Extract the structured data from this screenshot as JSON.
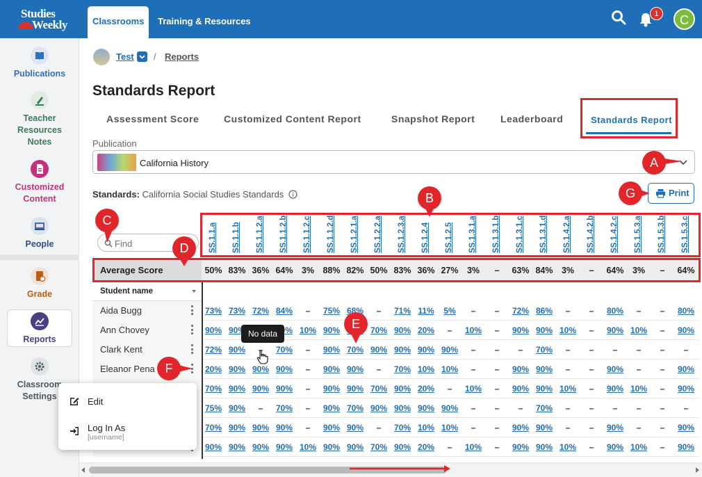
{
  "header": {
    "logo_line1": "Studies",
    "logo_line2": "Weekly",
    "tabs": [
      {
        "label": "Classrooms",
        "active": true
      },
      {
        "label": "Training & Resources",
        "active": false
      }
    ],
    "notification_count": "1",
    "avatar_initial": "C"
  },
  "sidebar": {
    "items": [
      {
        "label": "Publications",
        "icon": "book-icon",
        "color": "#2f6fbf"
      },
      {
        "label": "Teacher Resources Notes",
        "icon": "highlighter-icon",
        "color": "#3b7a5a"
      },
      {
        "label": "Customized Content",
        "icon": "document-icon",
        "color": "#c2317b"
      },
      {
        "label": "People",
        "icon": "people-icon",
        "color": "#2f4f86"
      },
      {
        "label": "Grade",
        "icon": "grade-icon",
        "color": "#b85e1a"
      },
      {
        "label": "Reports",
        "icon": "chart-icon",
        "color": "#4b3f83"
      },
      {
        "label": "Classroom Settings",
        "icon": "gear-icon",
        "color": "#4b5a60"
      }
    ]
  },
  "breadcrumb": {
    "classroom": "Test",
    "current": "Reports",
    "separator": "/"
  },
  "page": {
    "title": "Standards Report"
  },
  "report_tabs": [
    {
      "label": "Assessment Score",
      "active": false
    },
    {
      "label": "Customized Content Report",
      "active": false
    },
    {
      "label": "Snapshot Report",
      "active": false
    },
    {
      "label": "Leaderboard",
      "active": false
    },
    {
      "label": "Standards Report",
      "active": true
    }
  ],
  "publication": {
    "label": "Publication",
    "selected": "California History"
  },
  "standards": {
    "label": "Standards:",
    "value": "California Social Studies Standards"
  },
  "print_label": "Print",
  "find": {
    "placeholder": "Find"
  },
  "table": {
    "standard_codes": [
      "SS.1.1.a",
      "SS.1.1.b",
      "SS.1.1.2.a",
      "SS.1.1.2.b",
      "SS.1.1.2.c",
      "SS.1.1.2.d",
      "SS.1.2.1.a",
      "SS.1.2.2.a",
      "SS.1.2.3.a",
      "SS.1.2.4",
      "SS.1.2.5",
      "SS.1.3.1.a",
      "SS.1.3.1.b",
      "SS.1.3.1.c",
      "SS.1.3.1.d",
      "SS.1.4.2.a",
      "SS.1.4.2.b",
      "SS.1.4.2.c",
      "SS.1.5.3.a",
      "SS.1.5.3.b",
      "SS.1.5.3.c"
    ],
    "average_label": "Average Score",
    "averages": [
      "50%",
      "83%",
      "36%",
      "64%",
      "3%",
      "88%",
      "82%",
      "50%",
      "83%",
      "36%",
      "27%",
      "3%",
      "–",
      "63%",
      "84%",
      "3%",
      "–",
      "64%",
      "3%",
      "–",
      "64%"
    ],
    "name_header": "Student name",
    "rows": [
      {
        "name": "Aida Bugg",
        "values": [
          "73%",
          "73%",
          "72%",
          "84%",
          "–",
          "75%",
          "68%",
          "–",
          "71%",
          "11%",
          "5%",
          "–",
          "–",
          "72%",
          "86%",
          "–",
          "–",
          "80%",
          "–",
          "–",
          "80%"
        ]
      },
      {
        "name": "Ann Chovey",
        "values": [
          "90%",
          "90%",
          "",
          "90%",
          "10%",
          "90%",
          "90%",
          "70%",
          "90%",
          "20%",
          "–",
          "10%",
          "–",
          "90%",
          "90%",
          "10%",
          "–",
          "90%",
          "10%",
          "–",
          "90%"
        ]
      },
      {
        "name": "Clark Kent",
        "values": [
          "72%",
          "90%",
          "–",
          "70%",
          "–",
          "90%",
          "70%",
          "90%",
          "90%",
          "90%",
          "90%",
          "–",
          "–",
          "–",
          "70%",
          "–",
          "–",
          "–",
          "–",
          "–",
          "–"
        ]
      },
      {
        "name": "Eleanor Pena",
        "values": [
          "20%",
          "90%",
          "90%",
          "90%",
          "–",
          "90%",
          "90%",
          "–",
          "70%",
          "10%",
          "10%",
          "–",
          "–",
          "90%",
          "90%",
          "–",
          "–",
          "90%",
          "–",
          "–",
          "90%"
        ]
      },
      {
        "name": "",
        "values": [
          "70%",
          "90%",
          "90%",
          "90%",
          "–",
          "90%",
          "90%",
          "70%",
          "90%",
          "20%",
          "–",
          "10%",
          "–",
          "90%",
          "90%",
          "10%",
          "–",
          "90%",
          "10%",
          "–",
          "90%"
        ]
      },
      {
        "name": "",
        "values": [
          "75%",
          "90%",
          "–",
          "70%",
          "–",
          "90%",
          "70%",
          "90%",
          "90%",
          "90%",
          "90%",
          "–",
          "–",
          "–",
          "70%",
          "–",
          "–",
          "–",
          "–",
          "–",
          "–"
        ]
      },
      {
        "name": "",
        "values": [
          "70%",
          "90%",
          "90%",
          "90%",
          "–",
          "90%",
          "90%",
          "–",
          "70%",
          "10%",
          "10%",
          "–",
          "–",
          "90%",
          "90%",
          "–",
          "–",
          "90%",
          "–",
          "–",
          "90%"
        ]
      },
      {
        "name": "",
        "values": [
          "90%",
          "90%",
          "90%",
          "90%",
          "10%",
          "90%",
          "90%",
          "70%",
          "90%",
          "20%",
          "–",
          "10%",
          "–",
          "90%",
          "90%",
          "10%",
          "–",
          "90%",
          "10%",
          "–",
          "90%"
        ]
      }
    ]
  },
  "context_menu": {
    "edit": "Edit",
    "login_as": "Log In As",
    "login_sub": "[username]"
  },
  "tooltip": "No data",
  "callouts": [
    "A",
    "B",
    "C",
    "D",
    "E",
    "F",
    "G"
  ],
  "colors": {
    "brand_blue": "#1f6fb8",
    "annotation_red": "#e0262b",
    "avatar_green": "#7cbc3c"
  }
}
